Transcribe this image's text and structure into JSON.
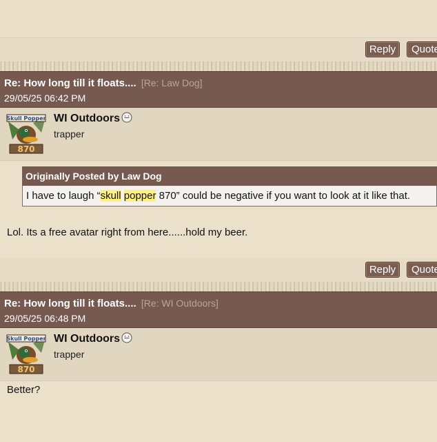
{
  "buttons": {
    "reply": "Reply",
    "quote": "Quote"
  },
  "posts": [
    {
      "title": "Re: How long till it floats....",
      "reply_to": "[Re: Law Dog]",
      "date": "29/05/25 06:42 PM",
      "username": "WI Outdoors",
      "rank": "trapper",
      "avatar_text": "Skull Popper",
      "avatar_number": "870",
      "quote": {
        "header": "Originally Posted by Law Dog",
        "before": "I have to laugh “",
        "highlight1": "skull",
        "between": " ",
        "highlight2": "popper",
        "after": " 870” could be negative if you want to look at it like that."
      },
      "message": "Lol. Its a free avatar right from here......hold my beer."
    },
    {
      "title": "Re: How long till it floats....",
      "reply_to": "[Re: WI Outdoors]",
      "date": "29/05/25 06:48 PM",
      "username": "WI Outdoors",
      "rank": "trapper",
      "avatar_text": "Skull Popper",
      "avatar_number": "870",
      "message": "Better?"
    }
  ],
  "colors": {
    "header": "#765a4f",
    "background": "#ebe1cb",
    "highlight": "#fff178"
  }
}
